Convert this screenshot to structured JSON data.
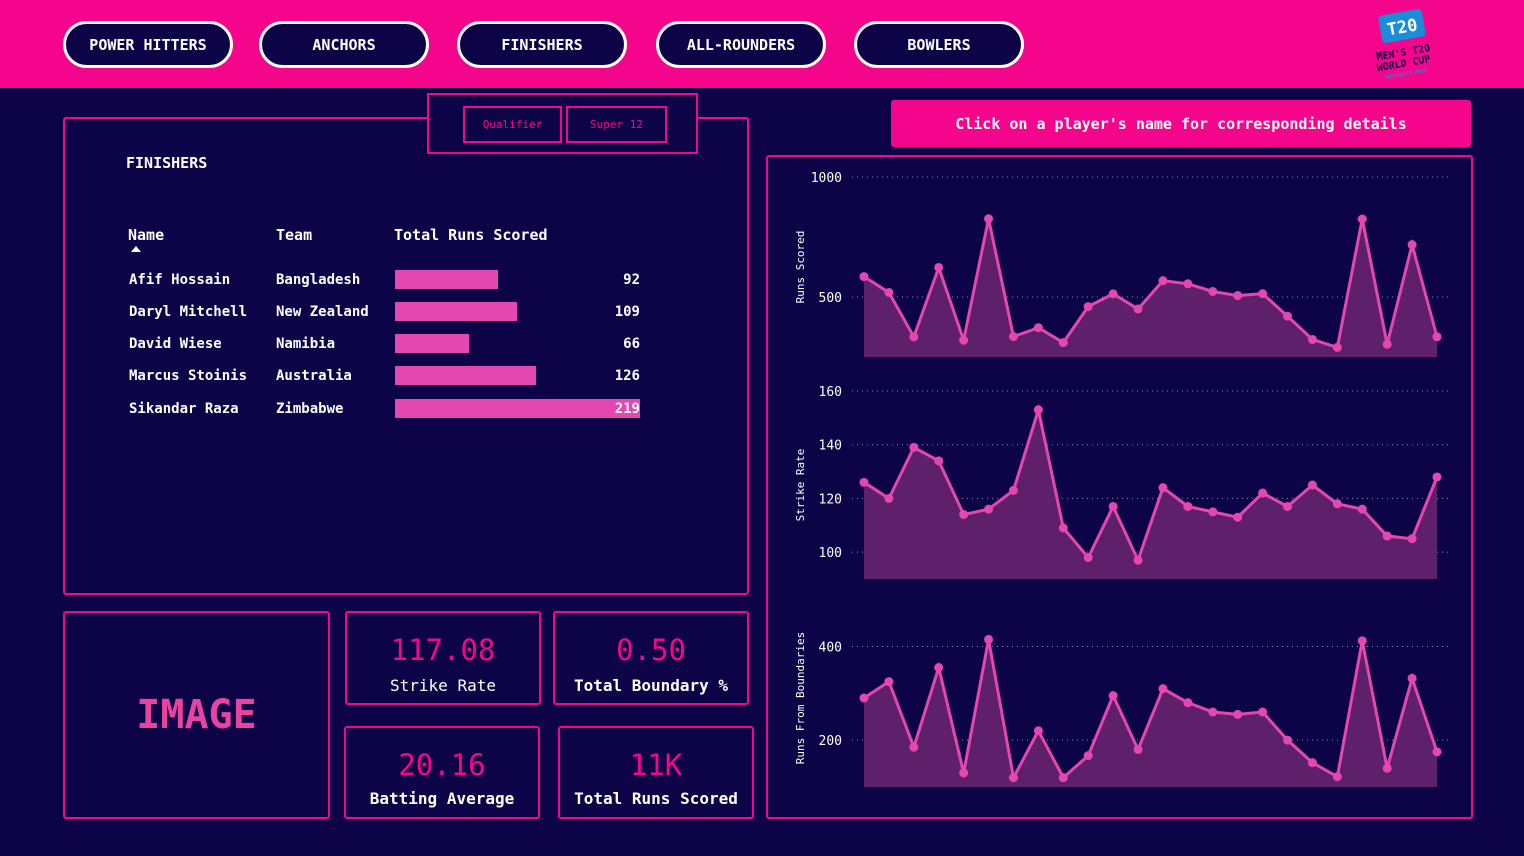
{
  "nav": {
    "tabs": [
      "POWER HITTERS",
      "ANCHORS",
      "FINISHERS",
      "ALL-ROUNDERS",
      "BOWLERS"
    ]
  },
  "logo": {
    "t20": "T20",
    "icc": "ICC",
    "line1": "MEN'S T20",
    "line2": "WORLD CUP",
    "line3": "AUSTRALIA 2022"
  },
  "filters": [
    "Qualifier",
    "Super 12"
  ],
  "hint": "Click on a player's name for corresponding details",
  "table": {
    "title": "FINISHERS",
    "columns": [
      "Name",
      "Team",
      "Total Runs Scored"
    ],
    "max_runs": 219,
    "rows": [
      {
        "name": "Afif Hossain",
        "team": "Bangladesh",
        "runs": "92",
        "value": 92
      },
      {
        "name": "Daryl Mitchell",
        "team": "New Zealand",
        "runs": "109",
        "value": 109
      },
      {
        "name": "David Wiese",
        "team": "Namibia",
        "runs": "66",
        "value": 66
      },
      {
        "name": "Marcus Stoinis",
        "team": "Australia",
        "runs": "126",
        "value": 126
      },
      {
        "name": "Sikandar Raza",
        "team": "Zimbabwe",
        "runs": "219",
        "value": 219
      }
    ]
  },
  "image_placeholder": "IMAGE",
  "kpis": {
    "strike_rate": {
      "value": "117.08",
      "label": "Strike Rate"
    },
    "boundary": {
      "value": "0.50",
      "label": "Total Boundary %"
    },
    "batting_avg": {
      "value": "20.16",
      "label": "Batting Average"
    },
    "total_runs": {
      "value": "11K",
      "label": "Total Runs Scored"
    }
  },
  "colors": {
    "accent": "#f5058c",
    "background": "#0d0448",
    "line": "#e447ad",
    "area": "#5e1f6b"
  },
  "chart_data": [
    {
      "type": "area",
      "ylabel": "Runs Scored",
      "ylim": [
        250,
        1000
      ],
      "yticks": [
        500,
        1000
      ],
      "grid": true,
      "values": [
        585,
        519,
        334,
        623,
        320,
        826,
        335,
        372,
        310,
        460,
        513,
        450,
        568,
        555,
        523,
        506,
        514,
        420,
        323,
        290,
        825,
        303,
        718,
        334
      ]
    },
    {
      "type": "area",
      "ylabel": "Strike Rate",
      "ylim": [
        90,
        160
      ],
      "yticks": [
        100,
        120,
        140,
        160
      ],
      "grid": true,
      "values": [
        126,
        120,
        139,
        134,
        114,
        116,
        123,
        153,
        109,
        98,
        117,
        97,
        124,
        117,
        115,
        113,
        122,
        117,
        125,
        118,
        116,
        106,
        105,
        128
      ]
    },
    {
      "type": "area",
      "ylabel": "Runs From Boundaries",
      "ylim": [
        100,
        480
      ],
      "yticks": [
        200,
        400
      ],
      "grid": true,
      "values": [
        290,
        325,
        185,
        355,
        130,
        415,
        120,
        220,
        120,
        167,
        295,
        180,
        310,
        280,
        260,
        255,
        260,
        200,
        152,
        122,
        412,
        140,
        332,
        175
      ]
    }
  ]
}
